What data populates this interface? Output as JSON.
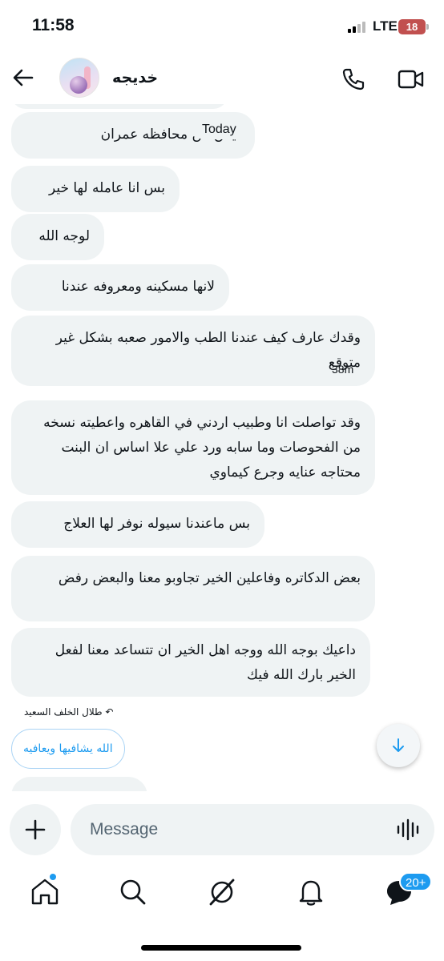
{
  "status_bar": {
    "time": "11:58",
    "network": "LTE",
    "battery": "18"
  },
  "header": {
    "contact_name": "خديجه"
  },
  "chat": {
    "today_label": "Today",
    "messages": [
      "ليمن من محافظه عمران",
      "بس انا عامله لها خير",
      "لوجه الله",
      "لانها مسكينه ومعروفه عندنا",
      "وقدك عارف كيف عندنا الطب والامور صعبه بشكل غير متوقع",
      "وقد تواصلت انا وطبيب اردني في القاهره واعطيته نسخه من الفحوصات وما سابه ورد علي علا اساس ان البنت محتاجه عنايه وجرع كيماوي",
      "بس ماعندنا سيوله نوفر لها العلاج",
      "بعض الدكاتره وفاعلين الخير تجاوبو معنا والبعض رفض",
      "داعيك بوجه الله ووجه اهل الخير ان تتساعد معنا لفعل الخير بارك الله فيك"
    ],
    "timestamp": "38m",
    "reply_indicator": "طلال الخلف السعيد",
    "reply_suggestion": "الله يشافيها ويعافيه"
  },
  "composer": {
    "placeholder": "Message"
  },
  "nav": {
    "messages_badge": "20+"
  },
  "colors": {
    "accent": "#1d9bf0",
    "bubble": "#eff3f4",
    "text": "#0f1419"
  },
  "icons": [
    "back-arrow-icon",
    "phone-icon",
    "video-icon",
    "arrow-down-icon",
    "plus-icon",
    "voice-wave-icon",
    "home-icon",
    "search-icon",
    "grok-icon",
    "bell-icon",
    "messages-icon"
  ]
}
